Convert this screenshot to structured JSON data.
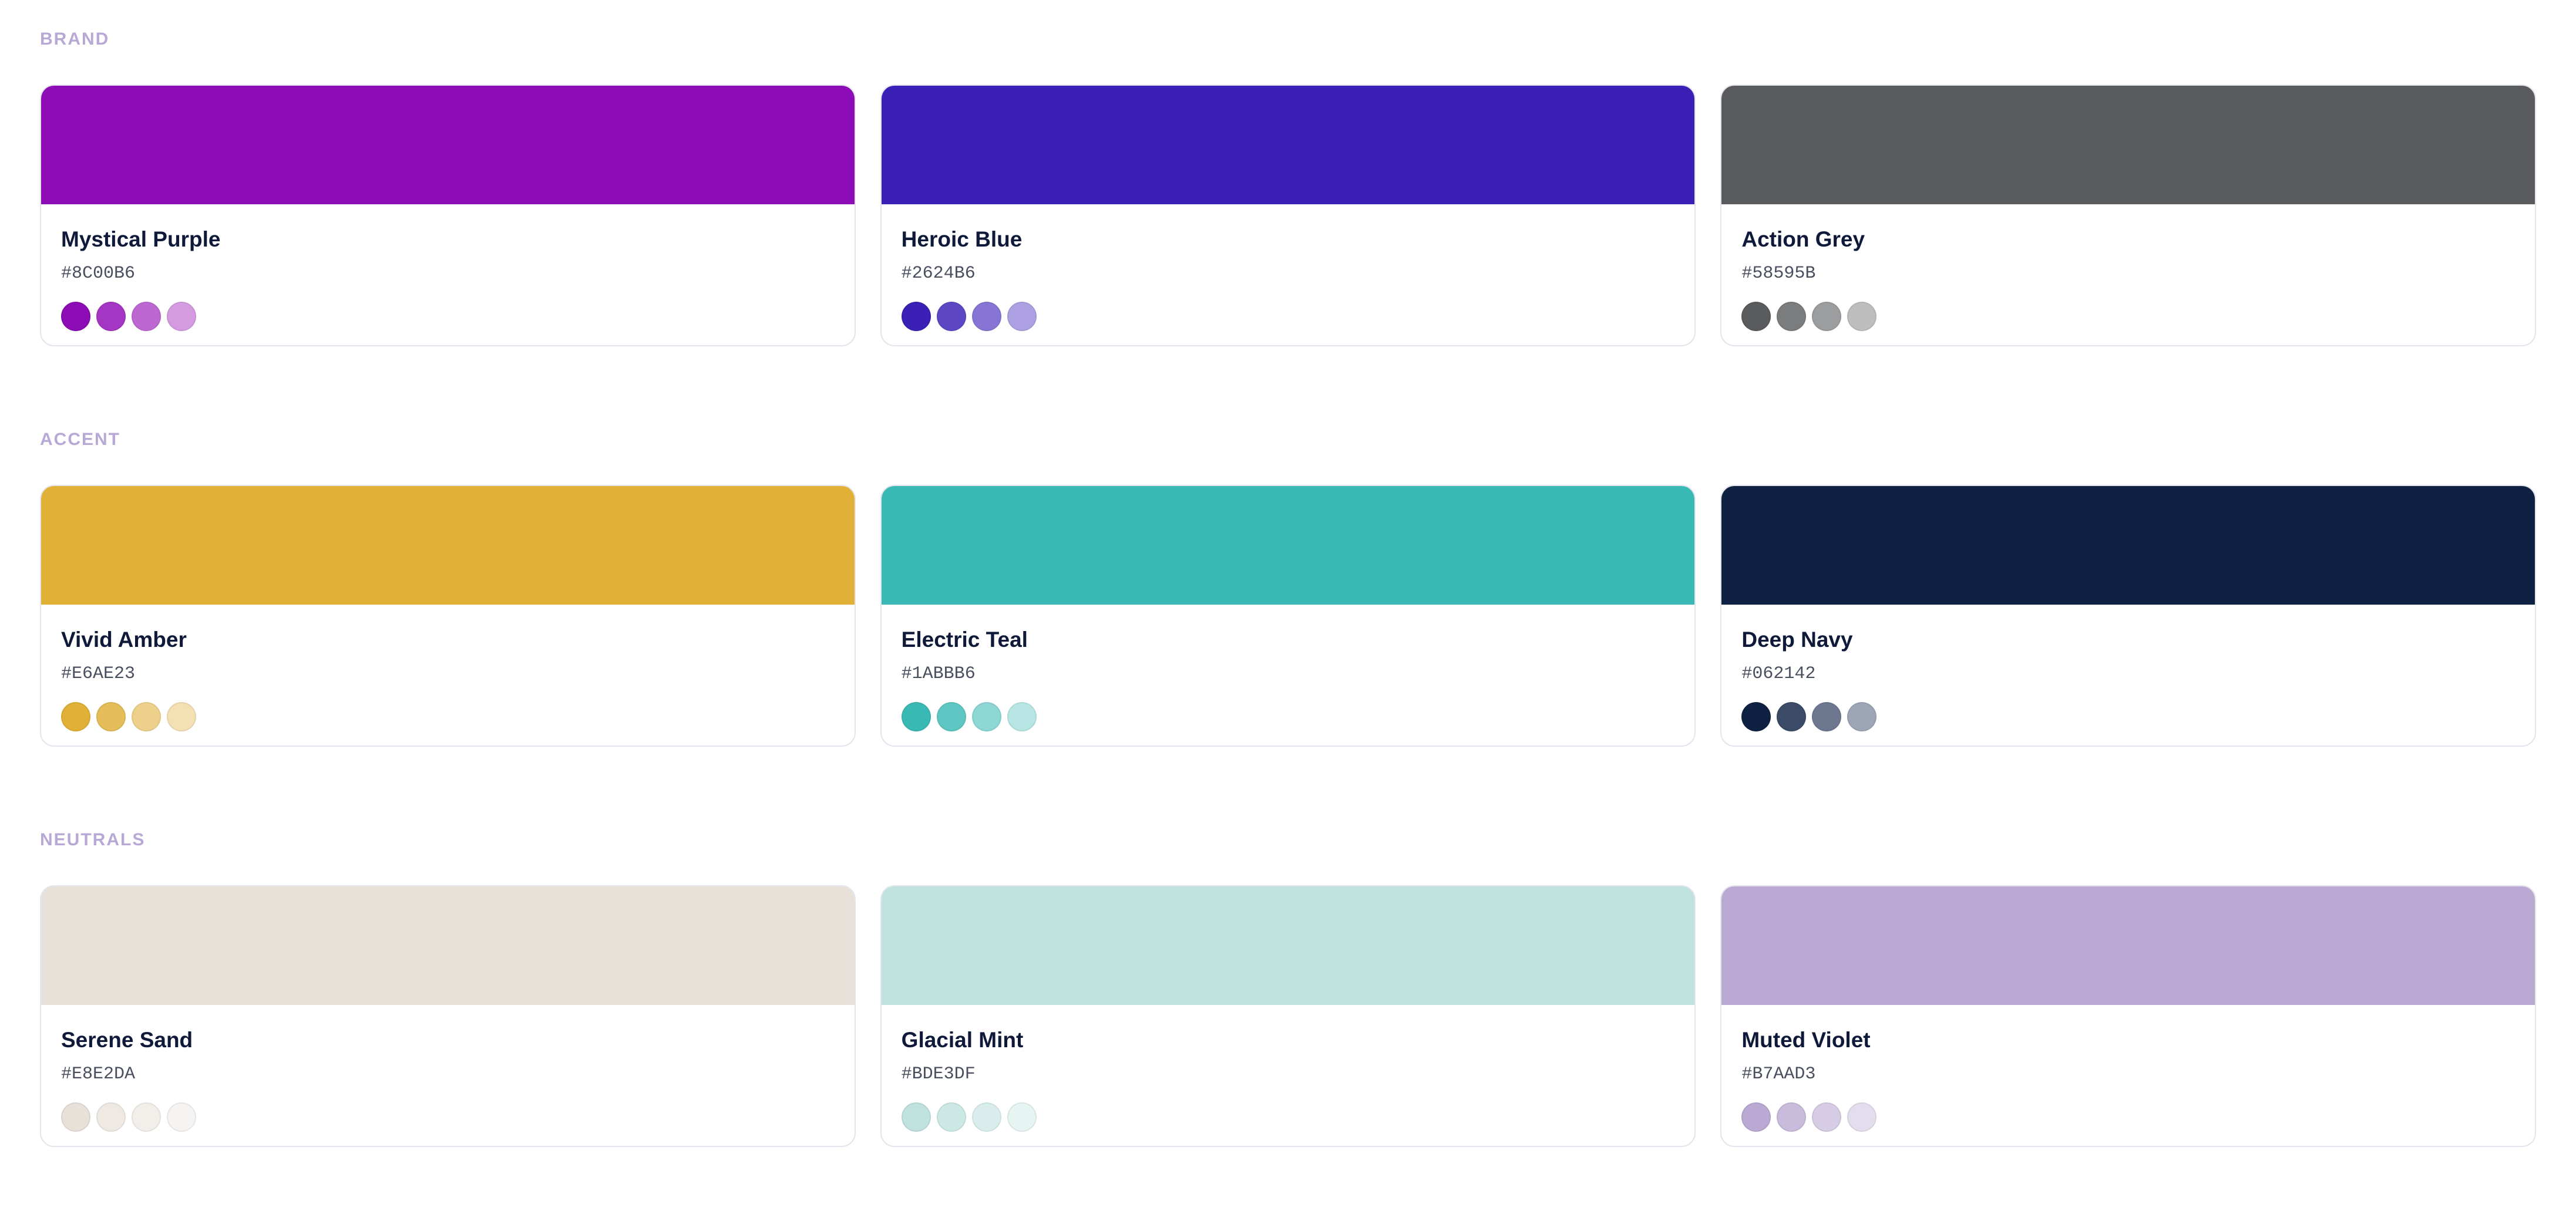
{
  "sections": [
    {
      "label": "BRAND",
      "cards": [
        {
          "name": "Mystical Purple",
          "hex": "#8C00B6",
          "color": "#8C0CB6",
          "tints": [
            "#8C0CB6",
            "#A535C3",
            "#BD68D2",
            "#D49BE1"
          ]
        },
        {
          "name": "Heroic Blue",
          "hex": "#2624B6",
          "color": "#3A20B6",
          "tints": [
            "#3A20B6",
            "#5D47C5",
            "#8675D4",
            "#ADA1E3"
          ]
        },
        {
          "name": "Action Grey",
          "hex": "#58595B",
          "color": "#5A5B5D",
          "tints": [
            "#5A5B5D",
            "#7B7C7E",
            "#9C9D9E",
            "#BEBEBF"
          ]
        }
      ]
    },
    {
      "label": "ACCENT",
      "cards": [
        {
          "name": "Vivid Amber",
          "hex": "#E6AE23",
          "color": "#E0B136",
          "tints": [
            "#E0B136",
            "#E5BE5A",
            "#EDD08A",
            "#F3E1B3"
          ]
        },
        {
          "name": "Electric Teal",
          "hex": "#1ABBB6",
          "color": "#3AB9B4",
          "tints": [
            "#3AB9B4",
            "#5FC7C3",
            "#8DD7D4",
            "#B6E5E3"
          ]
        },
        {
          "name": "Deep Navy",
          "hex": "#062142",
          "color": "#0F2142",
          "tints": [
            "#0F2142",
            "#3B4A66",
            "#6D7890",
            "#9EA6B6"
          ]
        }
      ]
    },
    {
      "label": "NEUTRALS",
      "cards": [
        {
          "name": "Serene Sand",
          "hex": "#E8E2DA",
          "color": "#E8E1DA",
          "tints": [
            "#E8E1DA",
            "#EEE9E3",
            "#F2EFEB",
            "#F6F4F2"
          ]
        },
        {
          "name": "Glacial Mint",
          "hex": "#BDE3DF",
          "color": "#C0E2DF",
          "tints": [
            "#C0E2DF",
            "#CCE8E5",
            "#D9EEEC",
            "#E6F4F2"
          ]
        },
        {
          "name": "Muted Violet",
          "hex": "#B7AAD3",
          "color": "#BAA9D3",
          "tints": [
            "#BAA9D3",
            "#C8BBDC",
            "#D6CCE5",
            "#E4DDEE"
          ]
        }
      ]
    }
  ]
}
